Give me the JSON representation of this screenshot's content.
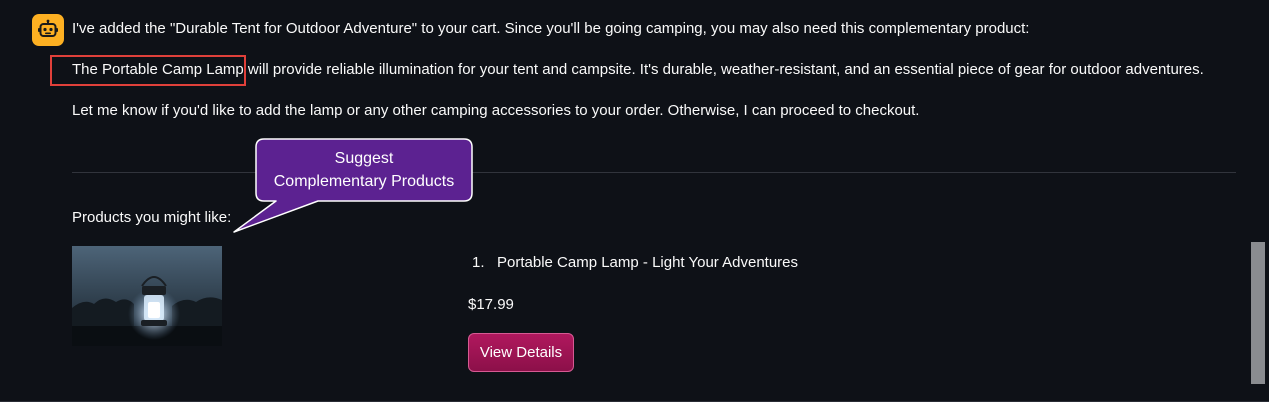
{
  "chat": {
    "message_line_1": "I've added the \"Durable Tent for Outdoor Adventure\" to your cart. Since you'll be going camping, you may also need this complementary product:",
    "message_line_2_highlight": "The Portable Camp Lamp",
    "message_line_2_rest": " will provide reliable illumination for your tent and campsite. It's durable, weather-resistant, and an essential piece of gear for outdoor adventures.",
    "message_line_3": "Let me know if you'd like to add the lamp or any other camping accessories to your order. Otherwise, I can proceed to checkout."
  },
  "annotation": {
    "line_1": "Suggest",
    "line_2": "Complementary Products",
    "fill_color": "#5c2291",
    "border_color": "#ffffff"
  },
  "products": {
    "heading": "Products you might like:",
    "items": [
      {
        "number": "1.",
        "name": "Portable Camp Lamp - Light Your Adventures",
        "price": "$17.99",
        "button_label": "View Details"
      }
    ]
  },
  "colors": {
    "background": "#0e1117",
    "avatar": "#fdb022",
    "highlight_box": "#e0403a",
    "button": "#9c1453"
  },
  "icons": {
    "avatar": "robot-icon",
    "product_image": "camp-lamp-photo"
  }
}
